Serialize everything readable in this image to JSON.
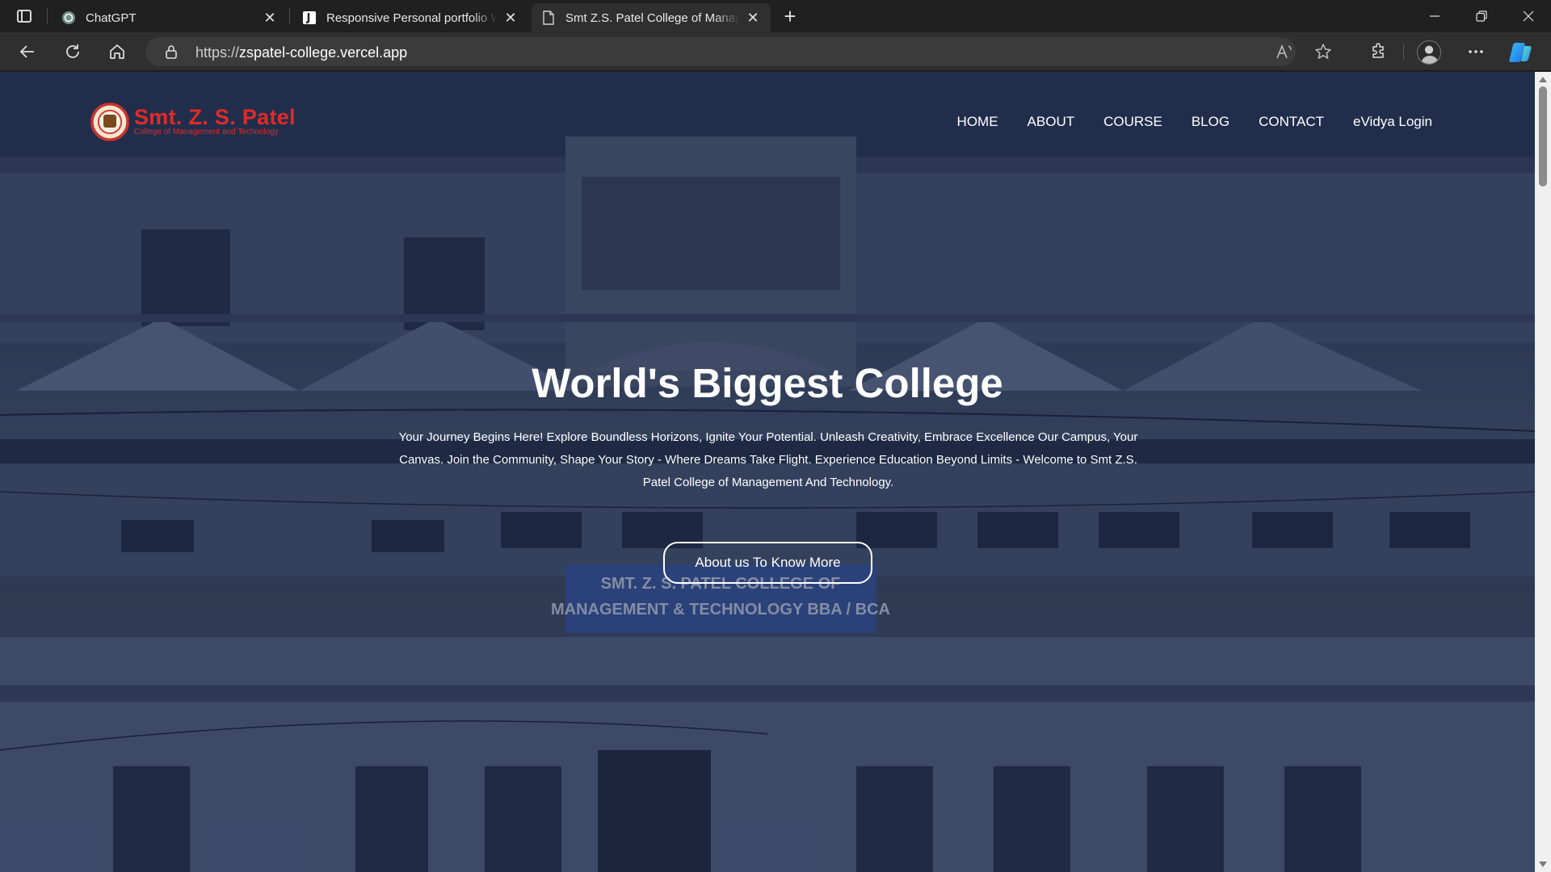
{
  "browser": {
    "tabs": [
      {
        "title": "ChatGPT",
        "icon": "chatgpt-icon",
        "active": false
      },
      {
        "title": "Responsive Personal portfolio We",
        "icon": "portfolio-icon",
        "active": false
      },
      {
        "title": "Smt Z.S. Patel College of Manage",
        "icon": "page-icon",
        "active": true
      }
    ],
    "url_prefix": "https://",
    "url_host": "zspatel-college.vercel.app"
  },
  "site": {
    "logo_name": "Smt. Z. S. Patel",
    "logo_subtitle": "College of Management and Technology",
    "nav": [
      "HOME",
      "ABOUT",
      "COURSE",
      "BLOG",
      "CONTACT",
      "eVidya Login"
    ],
    "headline": "World's Biggest College",
    "lead": "Your Journey Begins Here! Explore Boundless Horizons, Ignite Your Potential. Unleash Creativity, Embrace Excellence Our Campus, Your Canvas. Join the Community, Shape Your Story - Where Dreams Take Flight. Experience Education Beyond Limits - Welcome to Smt Z.S. Patel College of Management And Technology.",
    "cta_label": "About us To Know More",
    "building_sign_line1": "SMT. Z. S. PATEL COLLEGE OF",
    "building_sign_line2": "MANAGEMENT & TECHNOLOGY BBA / BCA"
  },
  "colors": {
    "brand_red": "#e02a2a",
    "chrome_dark": "#202020",
    "hero_overlay": "#1a2542"
  }
}
